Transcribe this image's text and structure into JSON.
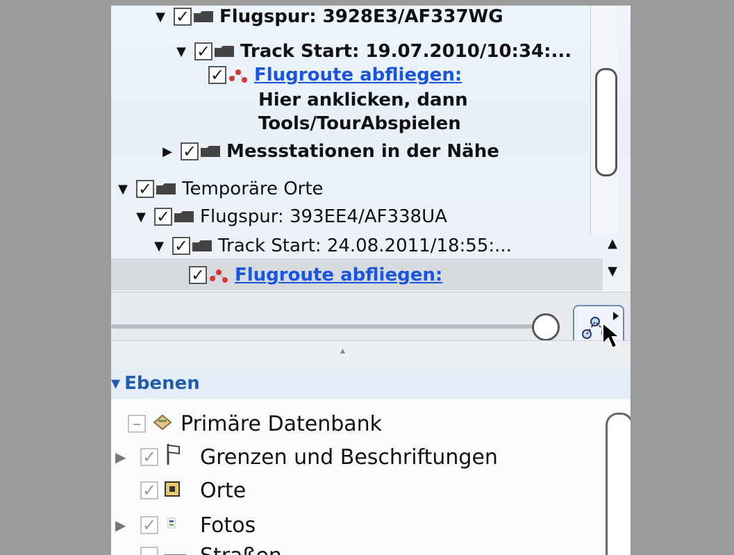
{
  "places_tree": {
    "items": [
      {
        "label": "Flugspur: 3928E3/AF337WG",
        "kind": "folder"
      },
      {
        "label": "Track Start: 19.07.2010/10:34:...",
        "kind": "folder"
      },
      {
        "label": "Flugroute abfliegen:",
        "kind": "tour-link"
      },
      {
        "label": "Hier anklicken, dann",
        "kind": "text"
      },
      {
        "label": "Tools/TourAbspielen",
        "kind": "text"
      },
      {
        "label": "Messstationen in der Nähe",
        "kind": "folder"
      },
      {
        "label": "Temporäre Orte",
        "kind": "folder"
      },
      {
        "label": "Flugspur: 393EE4/AF338UA",
        "kind": "folder"
      },
      {
        "label": "Track Start: 24.08.2011/18:55:...",
        "kind": "folder"
      },
      {
        "label": "Flugroute abfliegen:",
        "kind": "tour-link",
        "selected": true
      }
    ],
    "check_glyph": "✓",
    "expanded_glyph": "▼",
    "collapsed_glyph": "▶"
  },
  "scroll": {
    "up": "▲",
    "down": "▼"
  },
  "layers": {
    "title": "Ebenen",
    "title_glyph": "▾",
    "items": [
      {
        "label": "Primäre Datenbank",
        "icon": "database-icon"
      },
      {
        "label": "Grenzen und Beschriftungen",
        "icon": "flag-icon"
      },
      {
        "label": "Orte",
        "icon": "place-icon"
      },
      {
        "label": "Fotos",
        "icon": "photo-icon"
      },
      {
        "label": "Straßen",
        "icon": "road-icon"
      }
    ]
  },
  "colors": {
    "link": "#1a55e0",
    "layers_title": "#1f5db0",
    "selection": "#d7dbe0"
  }
}
